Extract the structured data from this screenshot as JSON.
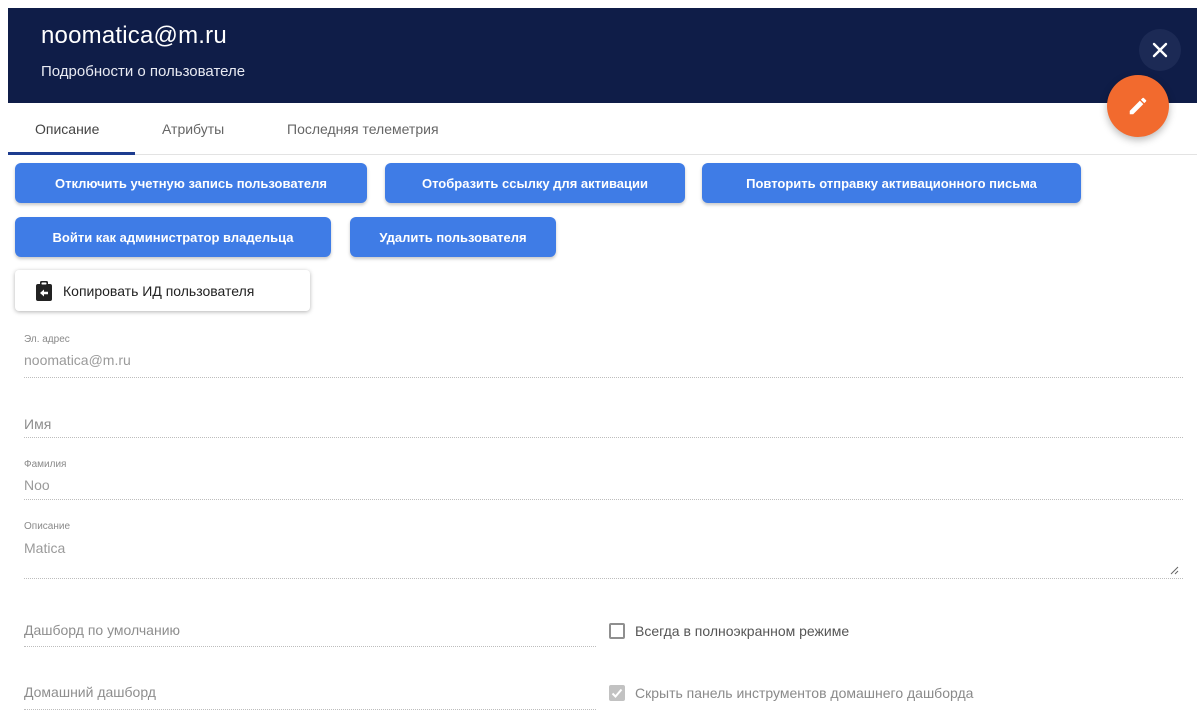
{
  "header": {
    "title": "noomatica@m.ru",
    "subtitle": "Подробности о пользователе",
    "background": "#0f1d48"
  },
  "close_icon": "close-icon",
  "edit_fab": {
    "icon": "pencil-icon",
    "color": "#f26a2e"
  },
  "tabs": [
    {
      "label": "Описание",
      "active": true
    },
    {
      "label": "Атрибуты",
      "active": false
    },
    {
      "label": "Последняя телеметрия",
      "active": false
    }
  ],
  "actions": {
    "disable_account": "Отключить учетную запись пользователя",
    "show_activation_link": "Отобразить ссылку для активации",
    "resend_activation_email": "Повторить отправку активационного письма",
    "login_as_owner_admin": "Войти как администратор владельца",
    "delete_user": "Удалить пользователя",
    "copy_user_id": "Копировать ИД пользователя",
    "copy_icon": "clipboard-arrow-icon",
    "accent": "#3f7ce6"
  },
  "form": {
    "email": {
      "label": "Эл. адрес",
      "value": "noomatica@m.ru"
    },
    "first_name": {
      "placeholder": "Имя"
    },
    "last_name": {
      "label": "Фамилия",
      "value": "Noo"
    },
    "description": {
      "label": "Описание",
      "value": "Matica"
    },
    "default_dashboard": {
      "placeholder": "Дашборд по умолчанию"
    },
    "always_fullscreen": {
      "label": "Всегда в полноэкранном режиме",
      "checked": false
    },
    "home_dashboard": {
      "placeholder": "Домашний дашборд"
    },
    "hide_home_toolbar": {
      "label": "Скрыть панель инструментов домашнего дашборда",
      "checked": true,
      "disabled": true
    }
  }
}
